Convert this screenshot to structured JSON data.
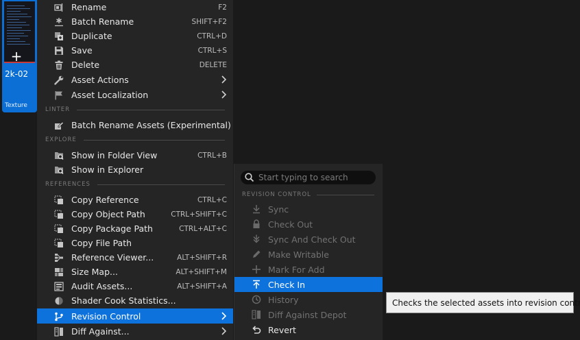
{
  "asset": {
    "name": "2k-02",
    "type": "Texture"
  },
  "menu": {
    "items": [
      {
        "id": "rename",
        "label": "Rename",
        "shortcut": "F2",
        "icon": "rename-icon"
      },
      {
        "id": "batch-rename",
        "label": "Batch Rename",
        "shortcut": "SHIFT+F2",
        "icon": "asterisk-icon"
      },
      {
        "id": "duplicate",
        "label": "Duplicate",
        "shortcut": "CTRL+D",
        "icon": "duplicate-icon"
      },
      {
        "id": "save",
        "label": "Save",
        "shortcut": "CTRL+S",
        "icon": "save-icon"
      },
      {
        "id": "delete",
        "label": "Delete",
        "shortcut": "DELETE",
        "icon": "trash-icon"
      },
      {
        "id": "asset-actions",
        "label": "Asset Actions",
        "icon": "wrench-icon",
        "submenu": true
      },
      {
        "id": "asset-localization",
        "label": "Asset Localization",
        "icon": "flag-icon",
        "submenu": true
      }
    ],
    "sections": {
      "linter": "LINTER",
      "explore": "EXPLORE",
      "references": "REFERENCES"
    },
    "linter_items": [
      {
        "id": "batch-rename-assets",
        "label": "Batch Rename Assets (Experimental)",
        "icon": "rename-tool-icon"
      }
    ],
    "explore_items": [
      {
        "id": "show-in-folder-view",
        "label": "Show in Folder View",
        "shortcut": "CTRL+B",
        "icon": "folder-search-icon"
      },
      {
        "id": "show-in-explorer",
        "label": "Show in Explorer",
        "icon": "folder-search-icon"
      }
    ],
    "reference_items": [
      {
        "id": "copy-reference",
        "label": "Copy Reference",
        "shortcut": "CTRL+C",
        "icon": "copy-icon"
      },
      {
        "id": "copy-object-path",
        "label": "Copy Object Path",
        "shortcut": "CTRL+SHIFT+C",
        "icon": "copy-icon"
      },
      {
        "id": "copy-package-path",
        "label": "Copy Package Path",
        "shortcut": "CTRL+ALT+C",
        "icon": "copy-icon"
      },
      {
        "id": "copy-file-path",
        "label": "Copy File Path",
        "icon": "copy-icon"
      },
      {
        "id": "reference-viewer",
        "label": "Reference Viewer...",
        "shortcut": "ALT+SHIFT+R",
        "icon": "graph-icon"
      },
      {
        "id": "size-map",
        "label": "Size Map...",
        "shortcut": "ALT+SHIFT+M",
        "icon": "size-map-icon"
      },
      {
        "id": "audit-assets",
        "label": "Audit Assets...",
        "shortcut": "ALT+SHIFT+A",
        "icon": "audit-icon"
      },
      {
        "id": "shader-cook-statistics",
        "label": "Shader Cook Statistics...",
        "icon": "shader-icon"
      },
      {
        "id": "revision-control",
        "label": "Revision Control",
        "icon": "branch-icon",
        "submenu": true,
        "highlighted": true
      },
      {
        "id": "diff-against",
        "label": "Diff Against...",
        "icon": "diff-icon",
        "submenu": true
      }
    ]
  },
  "submenu": {
    "search_placeholder": "Start typing to search",
    "section": "REVISION CONTROL",
    "items": [
      {
        "id": "sync",
        "label": "Sync",
        "icon": "download-icon",
        "enabled": false
      },
      {
        "id": "check-out",
        "label": "Check Out",
        "icon": "lock-icon",
        "enabled": false
      },
      {
        "id": "sync-and-check-out",
        "label": "Sync And Check Out",
        "icon": "double-download-icon",
        "enabled": false
      },
      {
        "id": "make-writable",
        "label": "Make Writable",
        "icon": "pencil-icon",
        "enabled": false
      },
      {
        "id": "mark-for-add",
        "label": "Mark For Add",
        "icon": "plus-icon",
        "enabled": false
      },
      {
        "id": "check-in",
        "label": "Check In",
        "icon": "upload-icon",
        "enabled": true,
        "highlighted": true
      },
      {
        "id": "history",
        "label": "History",
        "icon": "clock-icon",
        "enabled": false
      },
      {
        "id": "diff-against-depot",
        "label": "Diff Against Depot",
        "icon": "diff-icon",
        "enabled": false
      },
      {
        "id": "revert",
        "label": "Revert",
        "icon": "revert-icon",
        "enabled": true
      }
    ]
  },
  "tooltip": "Checks the selected assets into revision control.",
  "colors": {
    "highlight": "#0d72dc",
    "tile": "#0b6fd6",
    "menu_bg": "#252525"
  }
}
